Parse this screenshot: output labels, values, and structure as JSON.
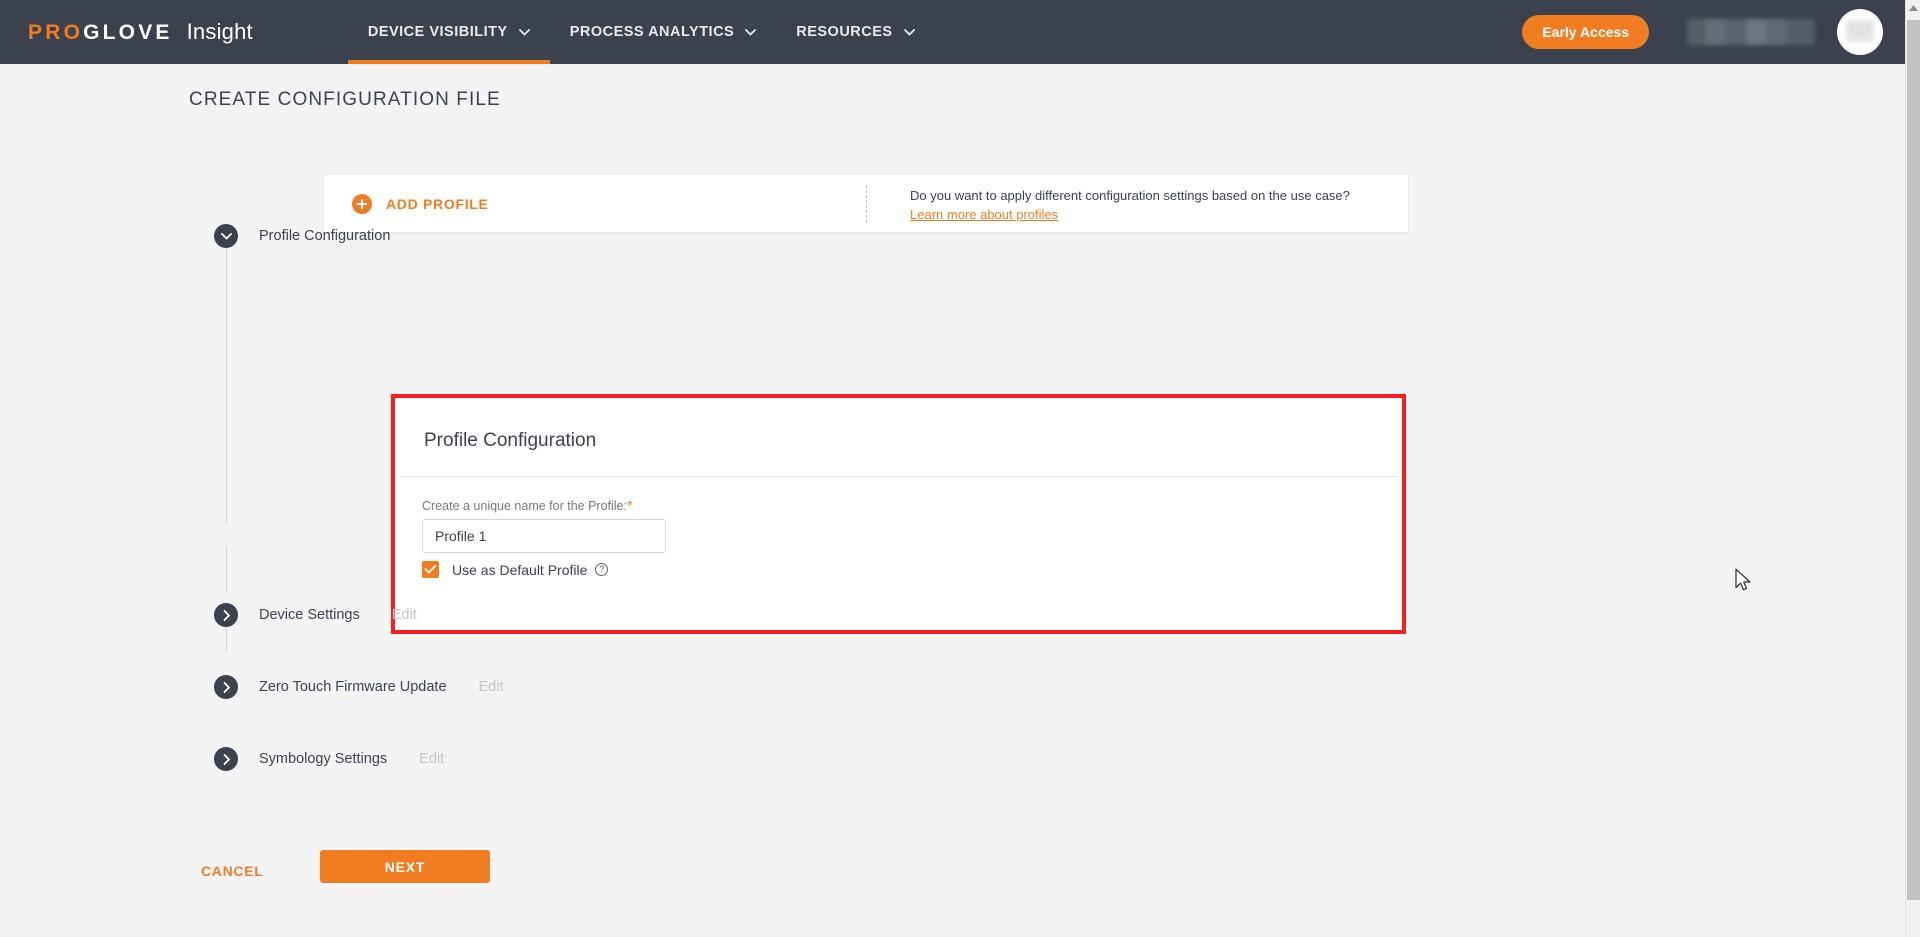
{
  "header": {
    "brand": {
      "pro": "PRO",
      "glove": "GLOVE",
      "product": "Insight"
    },
    "nav": [
      {
        "label": "DEVICE VISIBILITY",
        "icon": "chevron-down-icon",
        "active": true
      },
      {
        "label": "PROCESS ANALYTICS",
        "icon": "chevron-down-icon",
        "active": false
      },
      {
        "label": "RESOURCES",
        "icon": "chevron-down-icon",
        "active": false
      }
    ],
    "early_access_label": "Early Access",
    "user_name": "",
    "avatar_icon": "user-avatar-icon"
  },
  "page": {
    "title": "CREATE CONFIGURATION FILE"
  },
  "add_profile_card": {
    "button_label": "ADD PROFILE",
    "plus_icon": "plus-circle-icon",
    "info_text": "Do you want to apply different configuration settings based on the use case?",
    "info_link": "Learn more about profiles"
  },
  "steps": [
    {
      "label": "Profile Configuration",
      "icon": "chevron-down-icon",
      "expanded": true,
      "edit_label": ""
    },
    {
      "label": "Device Settings",
      "icon": "chevron-right-icon",
      "expanded": false,
      "edit_label": "Edit"
    },
    {
      "label": "Zero Touch Firmware Update",
      "icon": "chevron-right-icon",
      "expanded": false,
      "edit_label": "Edit"
    },
    {
      "label": "Symbology Settings",
      "icon": "chevron-right-icon",
      "expanded": false,
      "edit_label": "Edit"
    }
  ],
  "panel": {
    "title": "Profile Configuration",
    "field_label": "Create a unique name for the Profile:",
    "required_marker": "*",
    "profile_name_value": "Profile 1",
    "profile_name_placeholder": "Profile 1",
    "checkbox_label": "Use as Default Profile",
    "checkbox_checked": true,
    "help_icon": "question-mark-icon",
    "help_glyph": "?"
  },
  "footer": {
    "cancel_label": "CANCEL",
    "next_label": "NEXT"
  },
  "colors": {
    "brand_orange": "#f07d22",
    "header_dark": "#3b414d",
    "highlight_red": "#f41e1e",
    "page_bg": "#f4f4f4"
  }
}
